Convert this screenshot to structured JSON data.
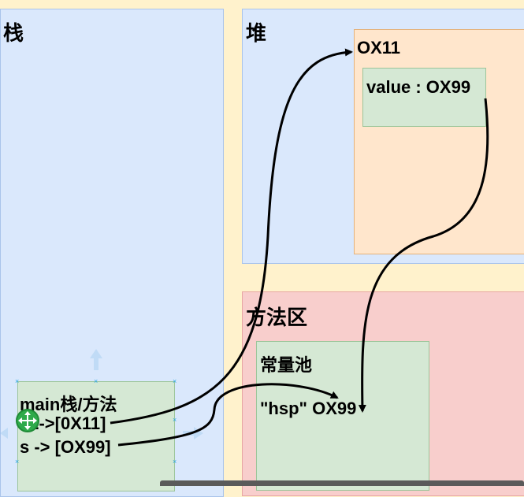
{
  "regions": {
    "stack_title": "栈",
    "heap_title": "堆",
    "method_area_title": "方法区"
  },
  "heap_object": {
    "address": "OX11",
    "field": "value : OX99"
  },
  "constant_pool": {
    "title": "常量池",
    "entry": "\"hsp\" OX99"
  },
  "main_frame": {
    "title": "main栈/方法",
    "var_line_1": "s2->[0X11]",
    "var_line_2": "s -> [OX99]"
  },
  "colors": {
    "background": "#fff2cc",
    "blue_region": "#dae8fc",
    "red_region": "#f8cecc",
    "orange_object": "#ffe6cc",
    "green_box": "#d5e8d4",
    "arrow": "#000000",
    "selection": "#29a6e0"
  },
  "icons": {
    "move_cursor": "move-cursor-icon",
    "selection_handles": "selection-handle-icon"
  }
}
